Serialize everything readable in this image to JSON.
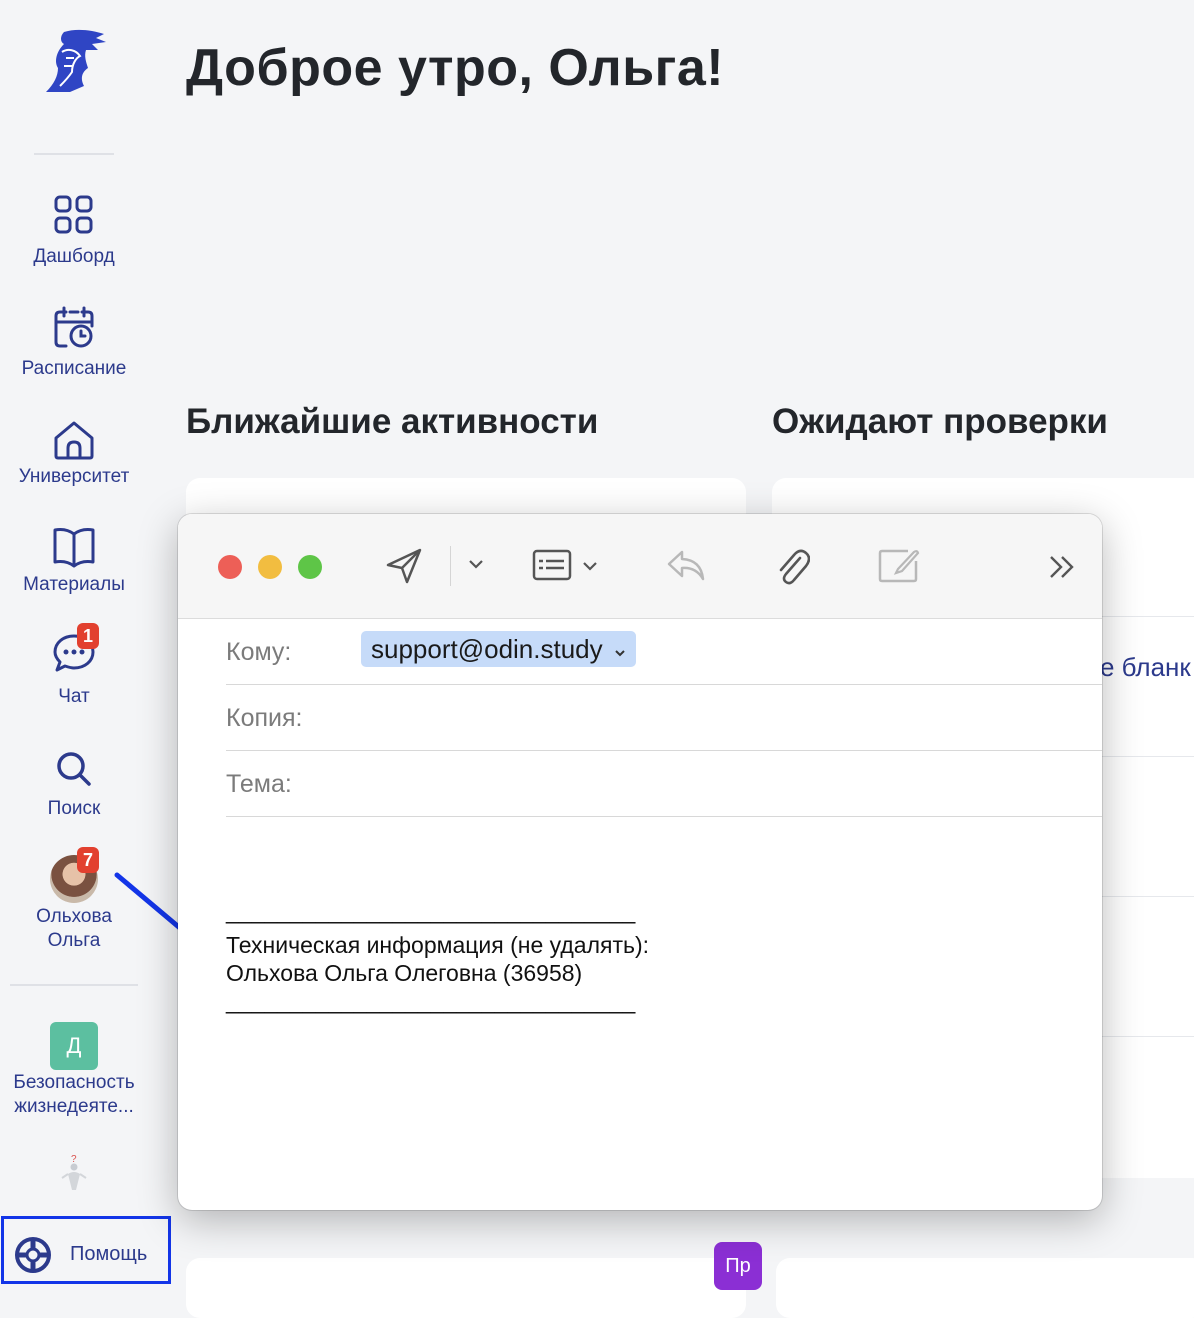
{
  "greeting": "Доброе утро, Ольга!",
  "sidebar": {
    "items": [
      {
        "label": "Дашборд",
        "icon": "grid-icon"
      },
      {
        "label": "Расписание",
        "icon": "calendar-clock-icon"
      },
      {
        "label": "Университет",
        "icon": "home-icon"
      },
      {
        "label": "Материалы",
        "icon": "book-icon"
      },
      {
        "label": "Чат",
        "icon": "chat-icon",
        "badge": "1"
      },
      {
        "label": "Поиск",
        "icon": "search-icon"
      }
    ],
    "profile": {
      "name_line1": "Ольхова",
      "name_line2": "Ольга",
      "badge": "7"
    },
    "course": {
      "initial": "Д",
      "name_line1": "Безопасность",
      "name_line2": "жизнедеяте..."
    },
    "help": "Помощь"
  },
  "sections": {
    "activities_title": "Ближайшие активности",
    "review_title": "Ожидают проверки",
    "right_peek": "е бланк",
    "pr_badge": "Пр"
  },
  "mail": {
    "to_label": "Кому:",
    "to_value": "support@odin.study",
    "cc_label": "Копия:",
    "subject_label": "Тема:",
    "body_separator": "________________________________",
    "body_line1": "Техническая информация (не удалять):",
    "body_line2": "Ольхова Ольга Олеговна (36958)"
  },
  "colors": {
    "accent": "#2c3a8c",
    "highlight": "#1335e8",
    "badge": "#e2402f",
    "token": "#c6dbf9"
  }
}
